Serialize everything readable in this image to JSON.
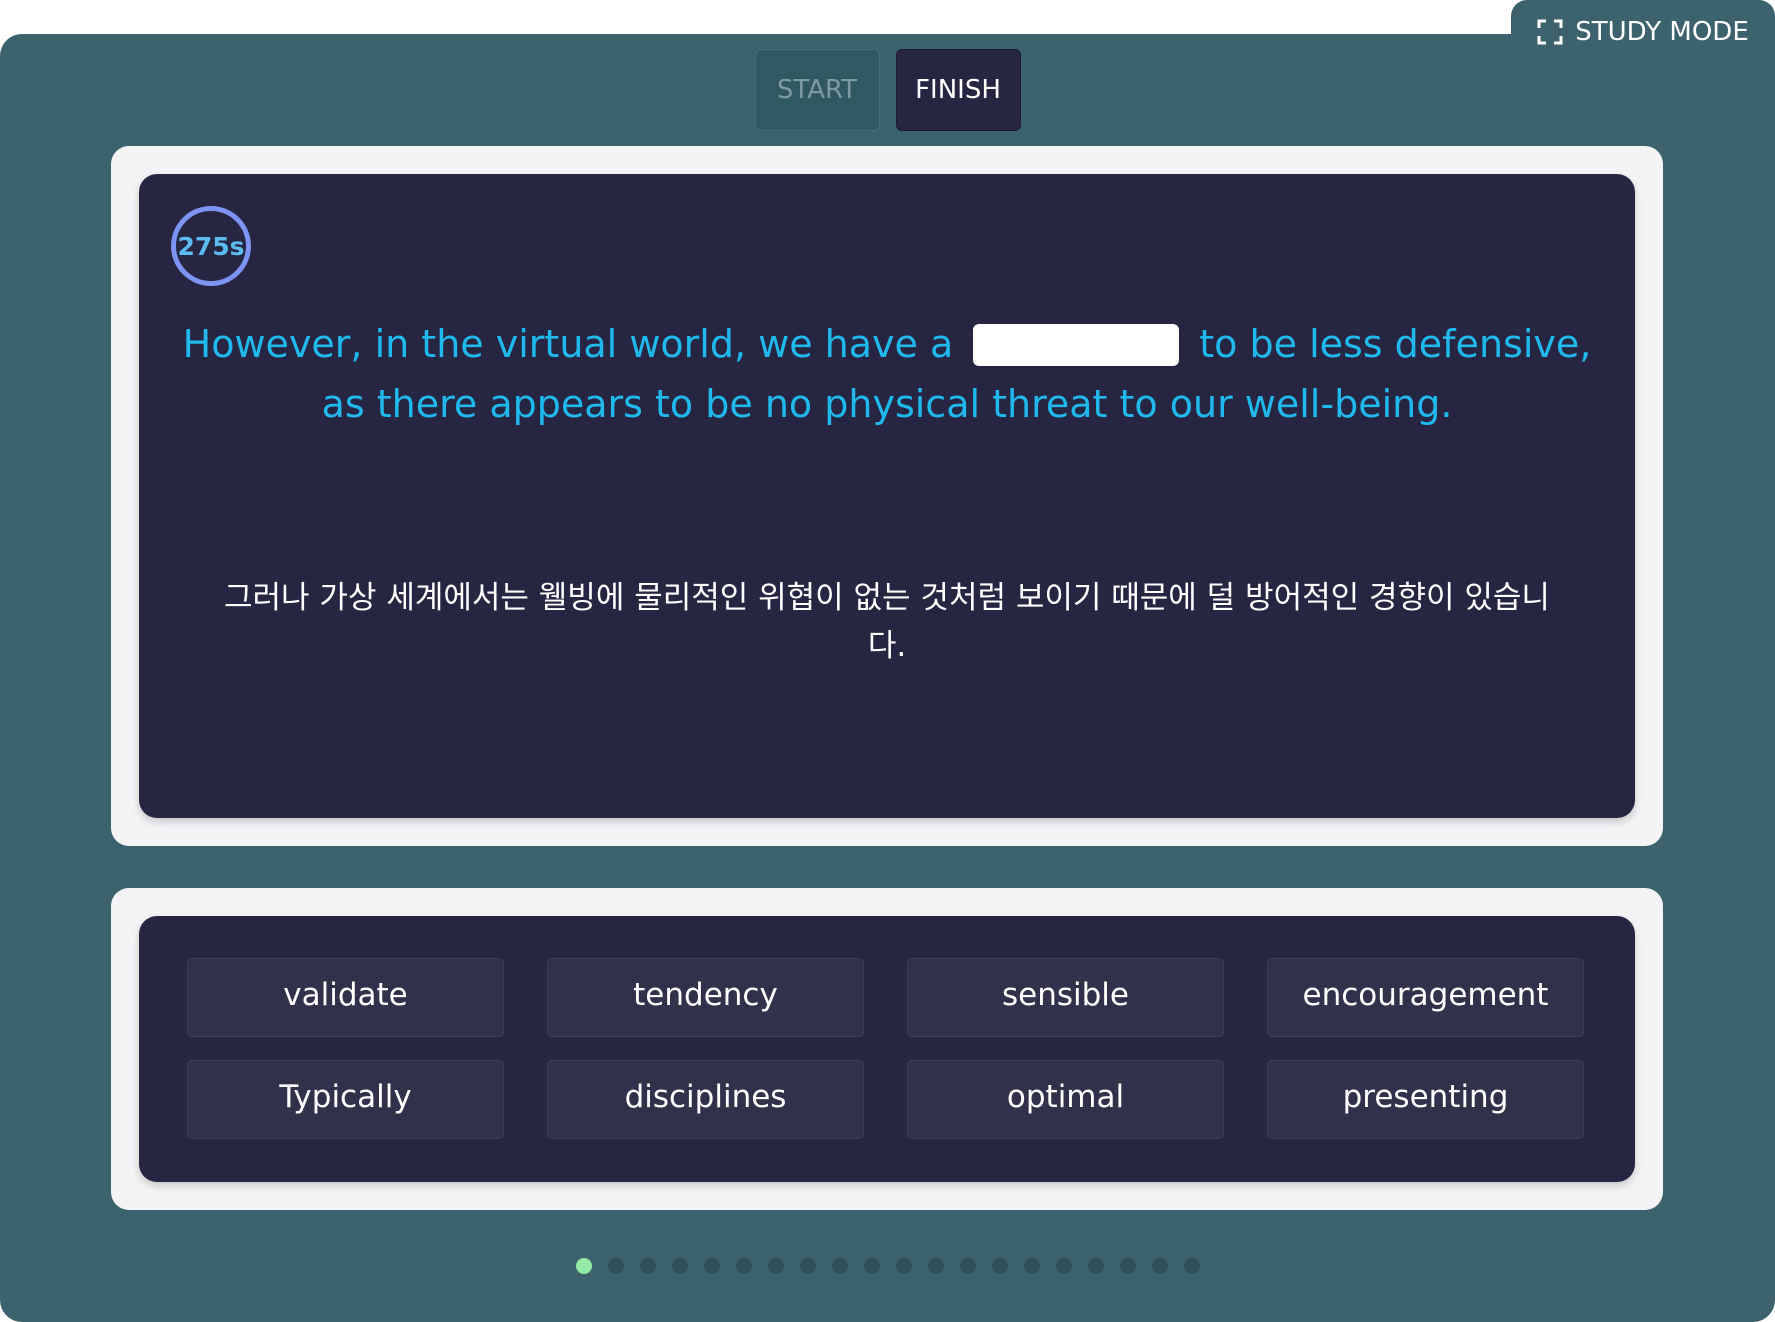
{
  "header": {
    "study_mode_label": "STUDY MODE",
    "start_label": "START",
    "finish_label": "FINISH"
  },
  "question": {
    "timer": "275s",
    "sentence_before": "However, in the virtual world, we have a",
    "sentence_after": "to be less defensive, as there appears to be no physical threat to our well-being.",
    "translation": "그러나 가상 세계에서는 웰빙에 물리적인 위협이 없는 것처럼 보이기 때문에 덜 방어적인 경향이 있습니다."
  },
  "choices": [
    "validate",
    "tendency",
    "sensible",
    "encouragement",
    "Typically",
    "disciplines",
    "optimal",
    "presenting"
  ],
  "pagination": {
    "total": 20,
    "current": 1
  },
  "colors": {
    "background": "#3c636d",
    "card": "#262642",
    "sentence_text": "#1fb9ee",
    "timer_ring": "#7d94f4",
    "active_dot": "#92e8a6"
  }
}
